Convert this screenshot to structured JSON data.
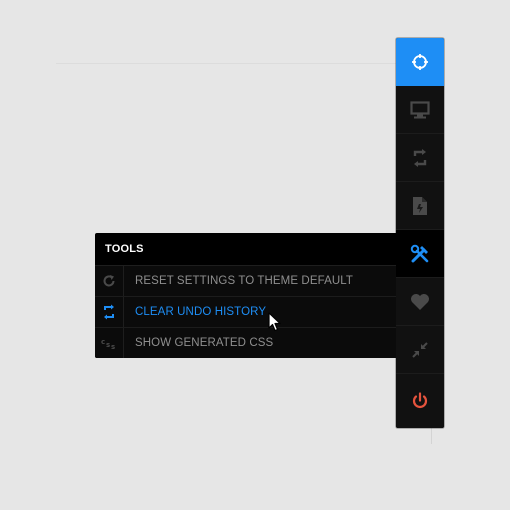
{
  "toolbar": {
    "buttons": [
      {
        "icon": "crosshair-icon",
        "state": "active"
      },
      {
        "icon": "monitor-icon"
      },
      {
        "icon": "sync-arrows-icon"
      },
      {
        "icon": "document-icon"
      },
      {
        "icon": "tools-icon",
        "state": "selected"
      },
      {
        "icon": "heart-icon"
      },
      {
        "icon": "collapse-arrows-icon"
      },
      {
        "icon": "power-icon"
      }
    ]
  },
  "tools_panel": {
    "title": "TOOLS",
    "items": [
      {
        "label": "RESET SETTINGS TO THEME DEFAULT",
        "icon": "refresh-icon"
      },
      {
        "label": "CLEAR UNDO HISTORY",
        "icon": "dollar-arrows-icon",
        "hover": true
      },
      {
        "label": "SHOW GENERATED CSS",
        "icon": "css-icon"
      }
    ]
  },
  "colors": {
    "accent": "#1e8ef5",
    "power": "#e5533d",
    "panel_bg": "#000000",
    "toolbar_bg": "#111111",
    "page_bg": "#e6e6e6",
    "label": "#8f8f8f"
  }
}
